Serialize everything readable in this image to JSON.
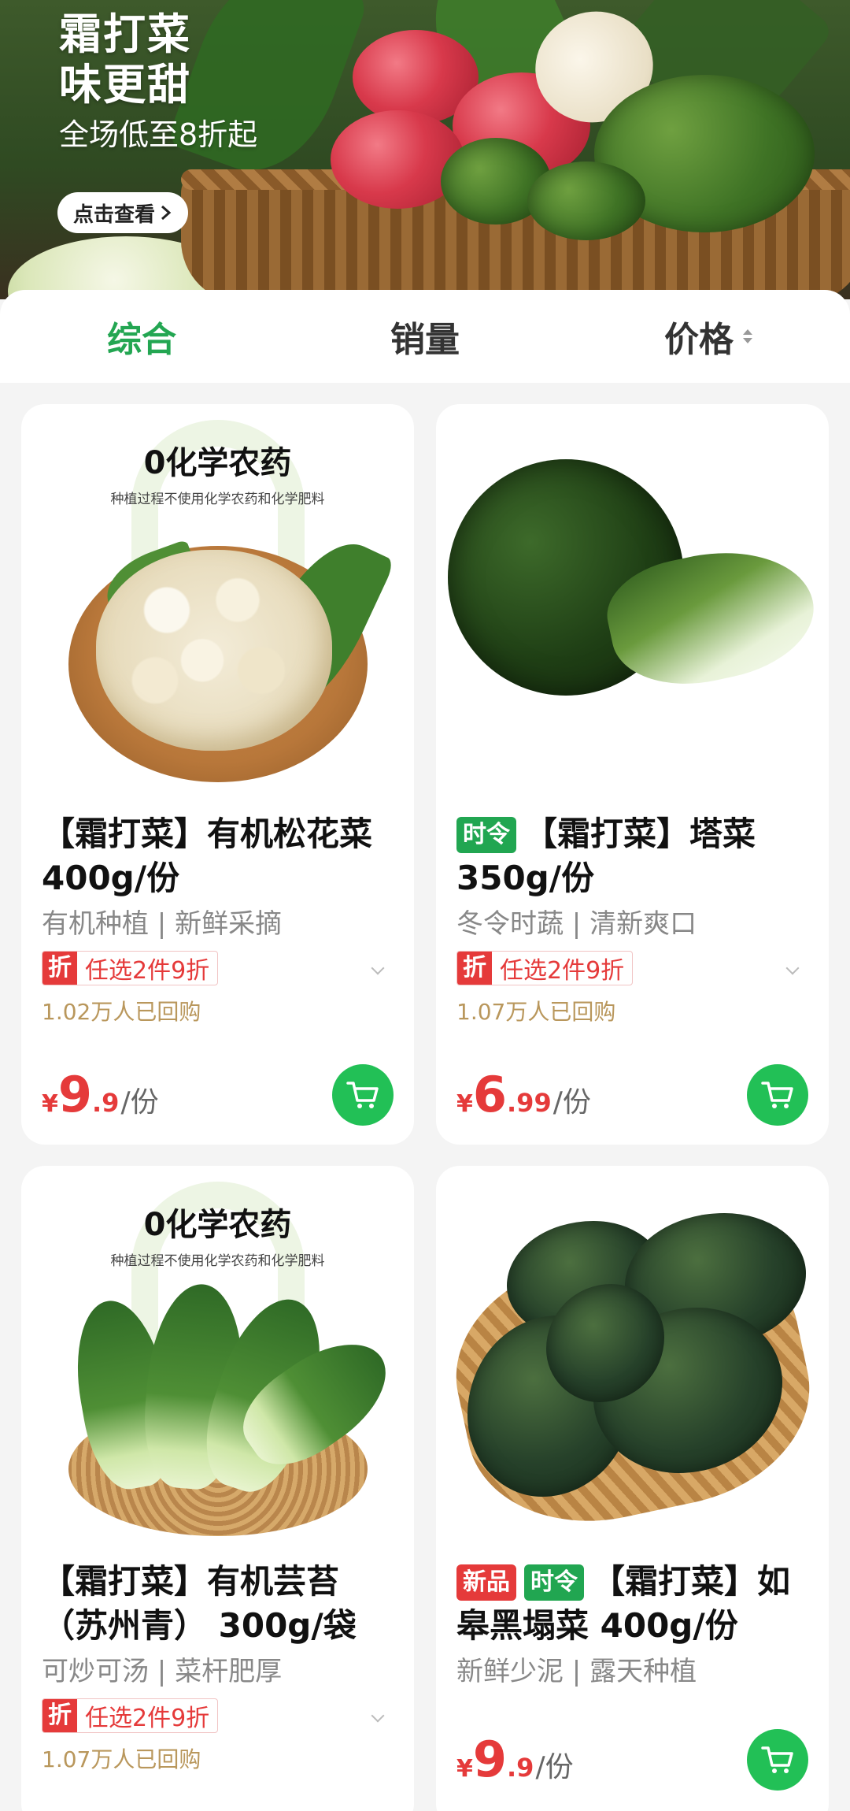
{
  "banner": {
    "title_line1": "霜打菜",
    "title_line2": "味更甜",
    "subtitle": "全场低至8折起",
    "button_label": "点击查看",
    "button_icon": "chevron-right-icon"
  },
  "sort_tabs": [
    {
      "label": "综合",
      "active": true
    },
    {
      "label": "销量",
      "active": false
    },
    {
      "label": "价格",
      "active": false,
      "icon": "sort-arrows-icon"
    }
  ],
  "colors": {
    "accent": "#23a652",
    "price": "#e53a3a",
    "cart": "#22c056",
    "buyers": "#b9975c"
  },
  "products": [
    {
      "image_badge": {
        "title": "0化学农药",
        "subtitle": "种植过程不使用化学农药和化学肥料"
      },
      "tags": [],
      "name": "【霜打菜】有机松花菜 400g/份",
      "features": "有机种植 | 新鲜采摘",
      "promo_icon": "折",
      "promo_text": "任选2件9折",
      "buyers": "1.02万人已回购",
      "price_currency": "¥",
      "price_int": "9",
      "price_dec": ".9",
      "price_unit": "/份"
    },
    {
      "tags": [
        "时令"
      ],
      "name": "【霜打菜】塔菜350g/份",
      "features": "冬令时蔬 | 清新爽口",
      "promo_icon": "折",
      "promo_text": "任选2件9折",
      "buyers": "1.07万人已回购",
      "price_currency": "¥",
      "price_int": "6",
      "price_dec": ".99",
      "price_unit": "/份"
    },
    {
      "image_badge": {
        "title": "0化学农药",
        "subtitle": "种植过程不使用化学农药和化学肥料"
      },
      "tags": [],
      "name": "【霜打菜】有机芸苔（苏州青） 300g/袋",
      "features": "可炒可汤 | 菜杆肥厚",
      "promo_icon": "折",
      "promo_text": "任选2件9折",
      "buyers": "1.07万人已回购"
    },
    {
      "tags": [
        "新品",
        "时令"
      ],
      "name": "【霜打菜】如皋黑塌菜 400g/份",
      "features": "新鲜少泥 | 露天种植",
      "price_currency": "¥",
      "price_int": "9",
      "price_dec": ".9",
      "price_unit": "/份"
    }
  ]
}
